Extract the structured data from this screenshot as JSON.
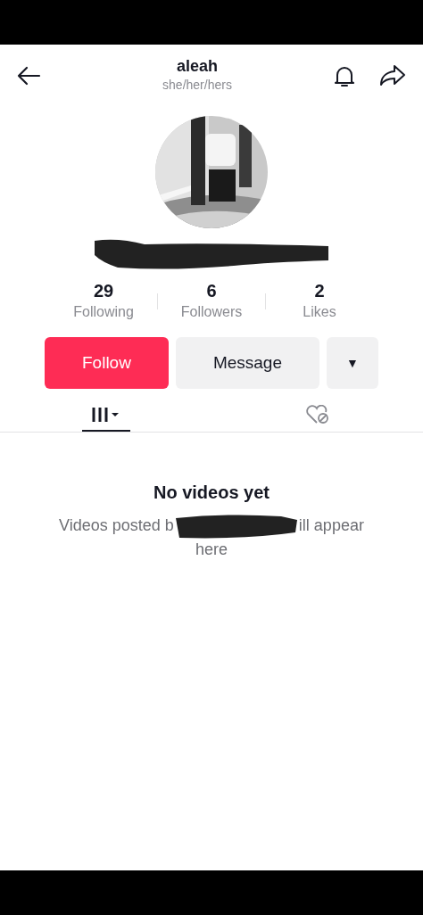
{
  "header": {
    "title": "aleah",
    "subtitle": "she/her/hers"
  },
  "stats": [
    {
      "value": "29",
      "label": "Following"
    },
    {
      "value": "6",
      "label": "Followers"
    },
    {
      "value": "2",
      "label": "Likes"
    }
  ],
  "buttons": [
    {
      "kind": "primary",
      "label": "Follow"
    },
    {
      "kind": "secondary",
      "label": "Message"
    },
    {
      "kind": "dropdown",
      "label": "▼"
    }
  ],
  "tabs": [
    {
      "kind": "videos",
      "selected": true
    },
    {
      "kind": "liked",
      "selected": false
    }
  ],
  "empty_state": {
    "title": "No videos yet",
    "text_before": "Videos posted b",
    "text_after": "ill appear",
    "text_last": "here"
  }
}
